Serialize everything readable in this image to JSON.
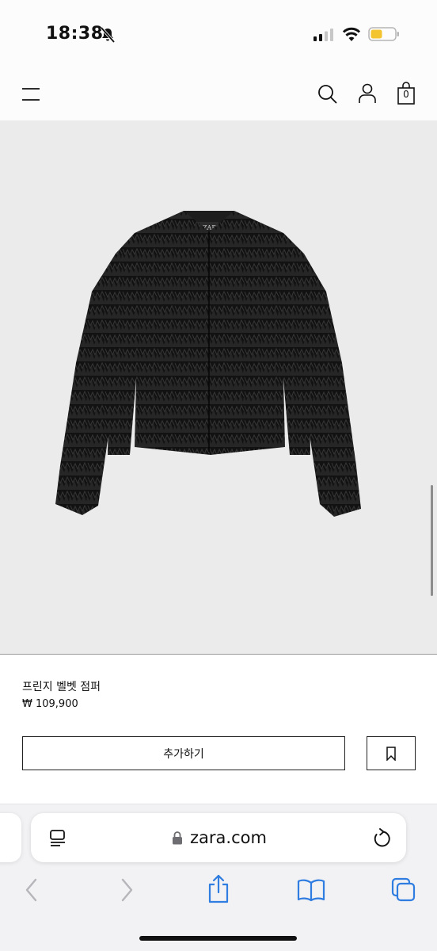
{
  "status_bar": {
    "time": "18:38",
    "icons": [
      "bell-slash-icon",
      "cellular-signal-icon",
      "wifi-icon",
      "battery-low-icon"
    ],
    "battery_color": "#f4c430"
  },
  "header": {
    "icons": [
      "menu-icon",
      "search-icon",
      "account-icon",
      "shopping-bag-icon"
    ],
    "bag_count": "0"
  },
  "product": {
    "image": "black-fringe-jacket",
    "name": "프린지 벨벳 점퍼",
    "price": "₩ 109,900",
    "add_button_label": "추가하기",
    "bookmark_icon": "bookmark-icon"
  },
  "safari": {
    "url": "zara.com",
    "icons": [
      "reader-icon",
      "lock-icon",
      "reload-icon",
      "back-icon",
      "forward-icon",
      "share-icon",
      "bookmarks-icon",
      "tabs-icon"
    ],
    "accent": "#2f7de1"
  }
}
